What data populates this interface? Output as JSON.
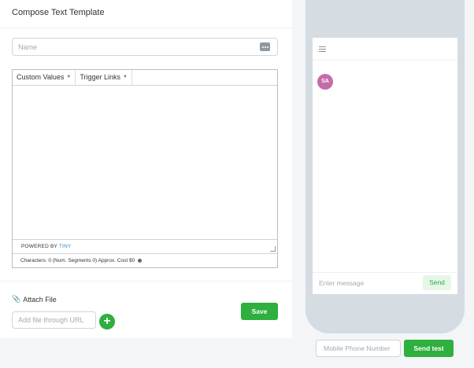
{
  "page": {
    "title": "Compose Text Template"
  },
  "name_field": {
    "placeholder": "Name",
    "value": "",
    "icon": "more-dots-icon"
  },
  "editor": {
    "toolbar": [
      {
        "label": "Custom Values"
      },
      {
        "label": "Trigger Links"
      }
    ],
    "content": "",
    "status": {
      "powered_by": "POWERED BY",
      "brand": "TINY"
    },
    "footer_text": "Characters: 0 (Num. Segments 0) Approx. Cost $0"
  },
  "attach": {
    "label": "Attach File",
    "url_placeholder": "Add file through URL",
    "add_symbol": "+"
  },
  "save_label": "Save",
  "preview": {
    "avatar_initials": "SA",
    "message_placeholder": "Enter message",
    "send_label": "Send"
  },
  "test": {
    "phone_placeholder": "Mobile Phone Number",
    "send_test_label": "Send test"
  },
  "colors": {
    "accent_green": "#2faf3e",
    "avatar_pink": "#c46ca8",
    "tiny_link": "#2c8bd7",
    "phone_frame": "#d5dce2"
  }
}
